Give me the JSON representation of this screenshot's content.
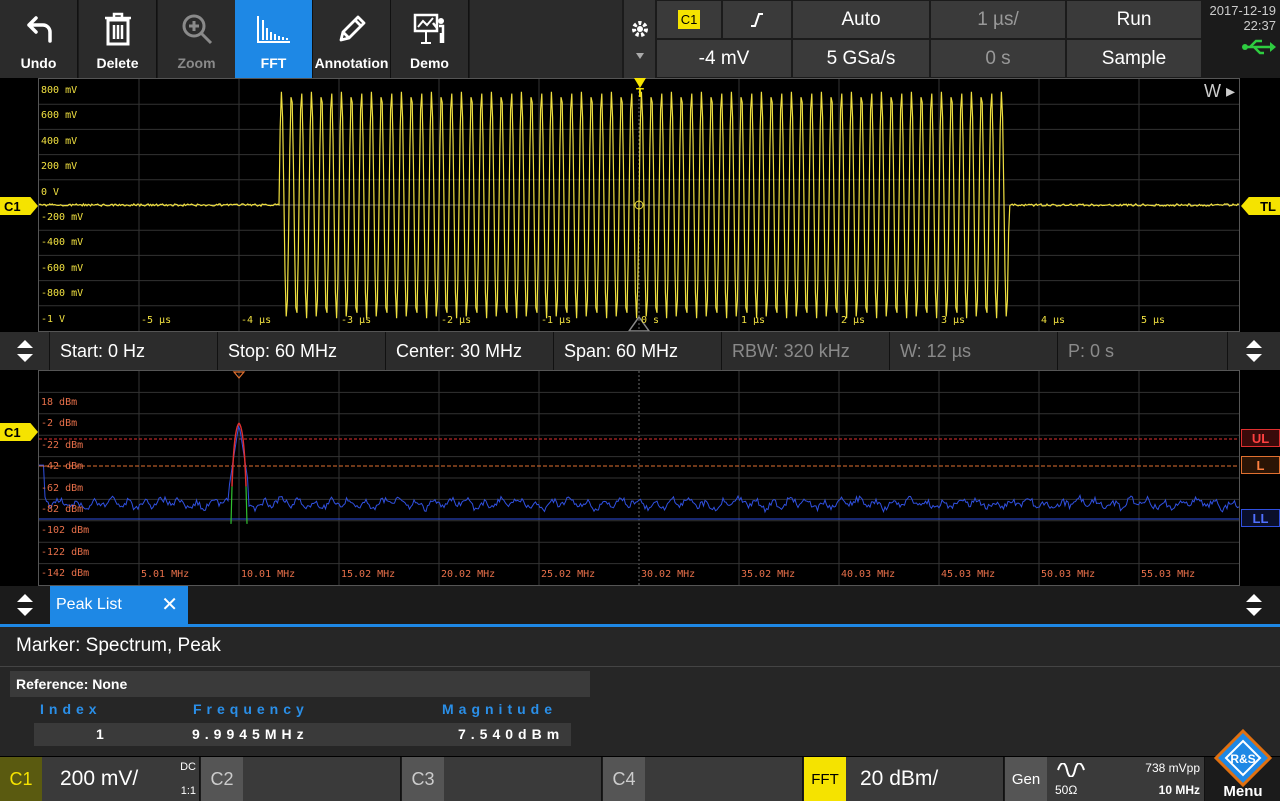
{
  "toolbar": {
    "buttons": [
      {
        "label": "Undo",
        "icon": "undo-icon",
        "state": "normal"
      },
      {
        "label": "Delete",
        "icon": "trash-icon",
        "state": "normal"
      },
      {
        "label": "Zoom",
        "icon": "zoom-icon",
        "state": "disabled"
      },
      {
        "label": "FFT",
        "icon": "fft-icon",
        "state": "active"
      },
      {
        "label": "Annotation",
        "icon": "pen-icon",
        "state": "normal"
      },
      {
        "label": "Demo",
        "icon": "presenter-icon",
        "state": "normal"
      }
    ],
    "settings_icon": "gear-icon"
  },
  "acq": {
    "trigger_source": "C1",
    "trigger_slope_icon": "rising-edge-icon",
    "trigger_mode": "Auto",
    "time_scale": "1 µs/",
    "run_state": "Run",
    "trigger_level": "-4 mV",
    "sample_rate": "5 GSa/s",
    "time_position": "0 s",
    "acq_mode": "Sample",
    "date": "2017-12-19",
    "time": "22:37",
    "usb_icon": "usb-icon"
  },
  "waveform": {
    "y_labels": [
      "800 mV",
      "600 mV",
      "400 mV",
      "200 mV",
      "0 V",
      "-200 mV",
      "-400 mV",
      "-600 mV",
      "-800 mV",
      "-1 V"
    ],
    "x_labels": [
      "-5 µs",
      "-4 µs",
      "-3 µs",
      "-2 µs",
      "-1 µs",
      "0 s",
      "1 µs",
      "2 µs",
      "3 µs",
      "4 µs",
      "5 µs"
    ],
    "channel_marker": "C1",
    "trigger_level_marker": "TL",
    "trigger_marker": "T",
    "window_marker": "W",
    "color": "#f0e040",
    "burst_start_us": -3.6,
    "burst_end_us": 3.7,
    "burst_cycles": 73,
    "amplitude_mv": 900
  },
  "fft": {
    "start": "Start: 0 Hz",
    "stop": "Stop: 60 MHz",
    "center": "Center: 30 MHz",
    "span": "Span: 60 MHz",
    "rbw": "RBW: 320 kHz",
    "window": "W: 12 µs",
    "position": "P: 0 s",
    "y_labels": [
      "18 dBm",
      "-2 dBm",
      "-22 dBm",
      "-42 dBm",
      "-62 dBm",
      "-82 dBm",
      "-102 dBm",
      "-122 dBm",
      "-142 dBm"
    ],
    "x_labels": [
      "5.01 MHz",
      "10.01 MHz",
      "15.02 MHz",
      "20.02 MHz",
      "25.02 MHz",
      "30.02 MHz",
      "35.02 MHz",
      "40.03 MHz",
      "45.03 MHz",
      "50.03 MHz",
      "55.03 MHz"
    ],
    "channel_marker": "C1",
    "upper_limit": "UL",
    "limit": "L",
    "lower_limit": "LL",
    "peak_freq_mhz": 10.0,
    "peak_dbm": -1,
    "noise_floor_dbm": -82,
    "trace_color": "#3050e0",
    "peak_color": "#e03030",
    "ul_color": "#e03030",
    "l_color": "#e07030",
    "ll_color": "#3050e0"
  },
  "peaklist": {
    "tab_label": "Peak List",
    "close_icon": "close-icon",
    "marker_title": "Marker: Spectrum, Peak",
    "reference": "Reference: None",
    "col_index": "Index",
    "col_frequency": "Frequency",
    "col_magnitude": "Magnitude",
    "rows": [
      {
        "index": "1",
        "frequency": "9.9945MHz",
        "magnitude": "7.540dBm"
      }
    ]
  },
  "bottom": {
    "c1_label": "C1",
    "c1_scale": "200 mV/",
    "c1_coupling": "DC",
    "c1_ratio": "1:1",
    "c2_label": "C2",
    "c3_label": "C3",
    "c4_label": "C4",
    "fft_label": "FFT",
    "fft_scale": "20 dBm/",
    "gen_label": "Gen",
    "gen_amplitude": "738 mVpp",
    "gen_impedance": "50Ω",
    "gen_freq": "10 MHz",
    "menu_label": "Menu"
  }
}
